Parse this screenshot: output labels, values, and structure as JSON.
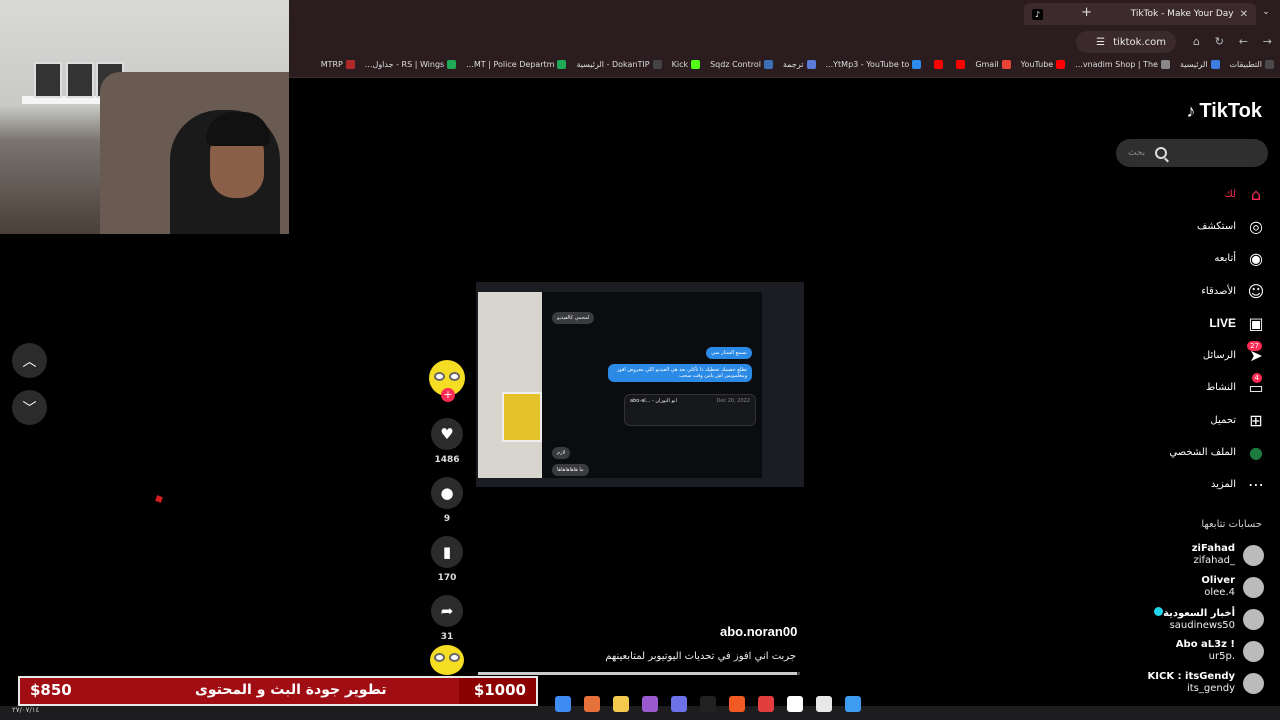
{
  "browser": {
    "tab_title": "TikTok - Make Your Day",
    "tab_favicon": "tiktok-icon",
    "new_tab_symbol": "+",
    "tab_close": "✕",
    "address": "tiktok.com"
  },
  "bookmarks": [
    {
      "label": "التطبيقات",
      "color": "#4a4a4a"
    },
    {
      "label": "الرئيسية",
      "color": "#3d7fe0"
    },
    {
      "label": "vnadim Shop | The...",
      "color": "#888888"
    },
    {
      "label": "YouTube",
      "color": "#ff0000"
    },
    {
      "label": "Gmail",
      "color": "#ea4335"
    },
    {
      "label": "",
      "color": "#ff0000"
    },
    {
      "label": "",
      "color": "#ff0000"
    },
    {
      "label": "YtMp3 - YouTube to...",
      "color": "#2d8cf0"
    },
    {
      "label": "ترجمة",
      "color": "#5a7bd8"
    },
    {
      "label": "Sqdz Control",
      "color": "#3b6fb6"
    },
    {
      "label": "Kick",
      "color": "#53fc18"
    },
    {
      "label": "DokanTIP - الرئيسية",
      "color": "#444444"
    },
    {
      "label": "MT | Police Departm...",
      "color": "#1fa855"
    },
    {
      "label": "RS | Wings - جداول...",
      "color": "#1fa855"
    },
    {
      "label": "MTRP",
      "color": "#b02a2a"
    }
  ],
  "tiktok": {
    "logo_text": "TikTok",
    "search_placeholder": "بحث",
    "nav": [
      {
        "label": "لك",
        "icon": "home-icon",
        "active": true
      },
      {
        "label": "استكشف",
        "icon": "compass-icon"
      },
      {
        "label": "أتابعه",
        "icon": "following-avatar-icon"
      },
      {
        "label": "الأصدقاء",
        "icon": "friends-icon"
      },
      {
        "label": "LIVE",
        "icon": "live-tv-icon"
      },
      {
        "label": "الرسائل",
        "icon": "send-icon",
        "badge": "27"
      },
      {
        "label": "النشاط",
        "icon": "message-icon",
        "badge": "4"
      },
      {
        "label": "تحميل",
        "icon": "upload-plus-icon"
      },
      {
        "label": "الملف الشخصي",
        "icon": "profile-avatar-icon"
      },
      {
        "label": "المزيد",
        "icon": "more-dots-icon"
      }
    ],
    "following_title": "حسابات تتابعها",
    "following": [
      {
        "name": "ziFahad",
        "handle": "zifahad_"
      },
      {
        "name": "Oliver",
        "handle": "olee.4"
      },
      {
        "name": "أخبار السعودية",
        "handle": "saudinews50",
        "verified": true
      },
      {
        "name": "Abo aL3z !",
        "handle": "ur5p."
      },
      {
        "name": "KICK : itsGendy",
        "handle": "its_gendy"
      }
    ],
    "video": {
      "username": "abo.noran00",
      "caption": "جربت اني افوز في تحديات اليوتيوبر لمتابعينهم",
      "likes": "1486",
      "comments": "9",
      "saves": "170",
      "shares": "31",
      "progress": 0.99,
      "chat_bubbles": [
        "لمحمي كالفيديو",
        "نسمع الستار سي",
        "تطلع خصمك تحطيك ذا تأكلي بعد هي الفيديو اللي معروض افوز وبتعلمويس اش يامن وقت سحب",
        "abo-al... - ابو النوران",
        "Dec 20, 2022",
        "لازم",
        "ما هاهاهاهاها"
      ]
    }
  },
  "stream_overlay": {
    "goal_current": "$850",
    "goal_title": "تطوير جودة البث و المحتوى",
    "goal_target": "$1000",
    "goal_fraction": 0.85
  },
  "taskbar": {
    "date": "٢٧/٠٧/١٤",
    "apps": [
      {
        "name": "chrome-icon",
        "color": "#3c8cf4"
      },
      {
        "name": "app-a-icon",
        "color": "#e8703a"
      },
      {
        "name": "folder-icon",
        "color": "#f2c94c"
      },
      {
        "name": "circle-app-icon",
        "color": "#9b59d0"
      },
      {
        "name": "discord-icon",
        "color": "#6c72e8"
      },
      {
        "name": "tiktok-app-icon",
        "color": "#222222"
      },
      {
        "name": "brave-icon",
        "color": "#f25a24"
      },
      {
        "name": "red-app-icon",
        "color": "#e43d3d"
      },
      {
        "name": "capcut-icon",
        "color": "#ffffff"
      },
      {
        "name": "store-icon",
        "color": "#e8e8e8"
      },
      {
        "name": "windows-icon",
        "color": "#3d9cf0"
      }
    ]
  }
}
